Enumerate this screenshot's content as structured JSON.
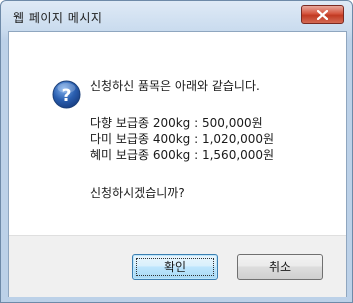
{
  "window": {
    "title": "웹 페이지 메시지"
  },
  "icons": {
    "dialog": "question-icon",
    "close": "close-icon"
  },
  "message": {
    "intro": "신청하신 품목은 아래와 같습니다.",
    "lines": [
      "다향 보급종 200kg : 500,000원",
      "다미 보급종 400kg : 1,020,000원",
      "혜미 보급종 600kg : 1,560,000원"
    ],
    "question": "신청하시겠습니까?"
  },
  "buttons": {
    "ok": "확인",
    "cancel": "취소"
  },
  "colors": {
    "close_button": "#d5553f",
    "icon_blue": "#2a5fb0",
    "primary_button_border": "#3c7fb1"
  }
}
